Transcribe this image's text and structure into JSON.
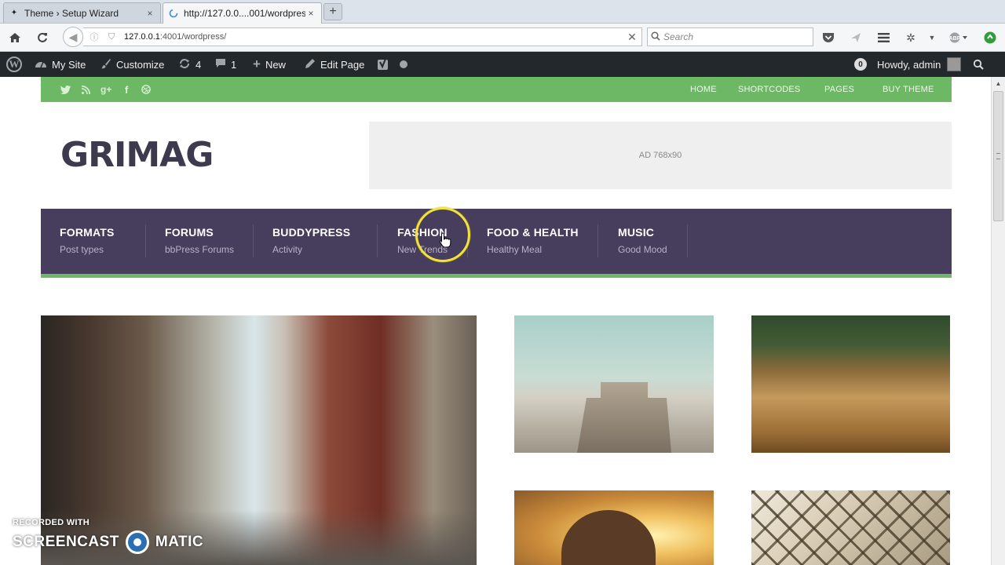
{
  "browser": {
    "tabs": [
      {
        "title": "Theme › Setup Wizard",
        "close": "×"
      },
      {
        "title": "http://127.0.0....001/wordpress/",
        "close": "×"
      }
    ],
    "new_tab": "+",
    "url_host": "127.0.0.1",
    "url_path": ":4001/wordpress/",
    "search_placeholder": "Search"
  },
  "adminbar": {
    "my_site": "My Site",
    "customize": "Customize",
    "updates_count": "4",
    "comments_count": "1",
    "new": "New",
    "edit_page": "Edit Page",
    "notif_count": "0",
    "howdy": "Howdy, admin"
  },
  "site": {
    "topnav": [
      "HOME",
      "SHORTCODES",
      "PAGES",
      "BUY THEME"
    ],
    "logo": "GRIMAG",
    "ad_text": "AD 768x90",
    "menu": [
      {
        "title": "FORMATS",
        "sub": "Post types"
      },
      {
        "title": "FORUMS",
        "sub": "bbPress Forums"
      },
      {
        "title": "BUDDYPRESS",
        "sub": "Activity"
      },
      {
        "title": "FASHION",
        "sub": "New Trends"
      },
      {
        "title": "FOOD & HEALTH",
        "sub": "Healthy Meal"
      },
      {
        "title": "MUSIC",
        "sub": "Good Mood"
      }
    ]
  },
  "watermark": {
    "line1": "RECORDED WITH",
    "line2a": "SCREENCAST",
    "line2b": "MATIC"
  },
  "colors": {
    "green": "#6db864",
    "purple": "#463e5c",
    "adminbar": "#23282d"
  }
}
